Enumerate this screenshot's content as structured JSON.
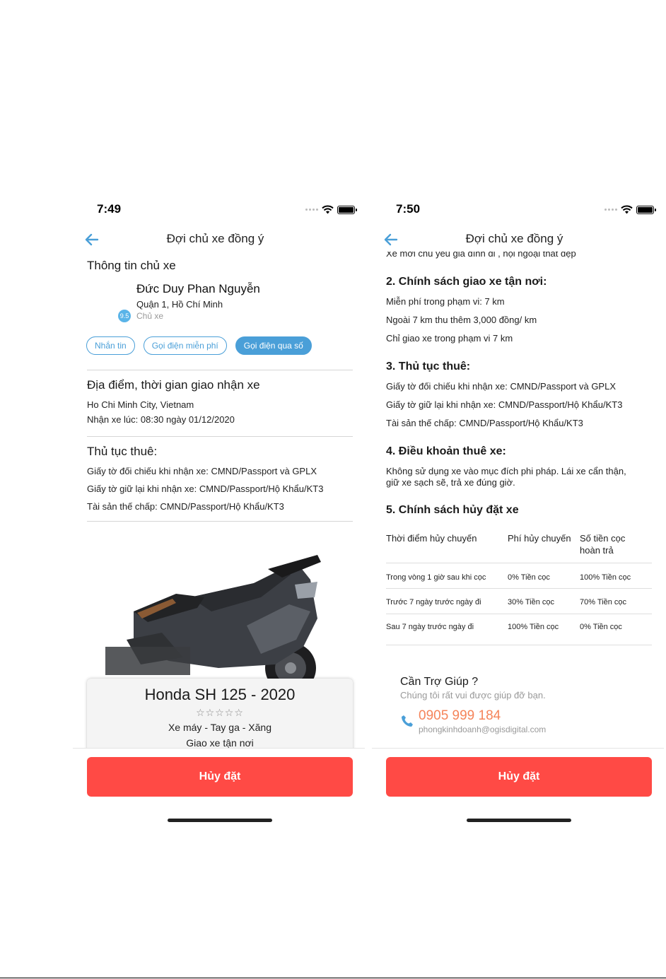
{
  "left": {
    "status_time": "7:49",
    "nav_title": "Đợi chủ xe đồng ý",
    "owner_section_title": "Thông tin chủ xe",
    "owner_name": "Đức Duy Phan Nguyễn",
    "owner_address": "Quận 1, Hồ Chí Minh",
    "owner_rating": "9.5",
    "owner_role": "Chủ xe",
    "buttons": {
      "message": "Nhắn tin",
      "free_call": "Gọi điện miễn phí",
      "phone_call": "Gọi điện qua số"
    },
    "location_title": "Địa điểm, thời gian giao nhận xe",
    "location": "Ho Chi Minh City, Vietnam",
    "pickup_time": "Nhận xe lúc: 08:30 ngày 01/12/2020",
    "procedure_title": "Thủ tục thuê:",
    "procedures": [
      "Giấy tờ đối chiếu khi nhận xe: CMND/Passport và GPLX",
      "Giấy tờ giữ lại khi nhận xe: CMND/Passport/Hộ Khẩu/KT3",
      "Tài sản thế chấp: CMND/Passport/Hộ Khẩu/KT3"
    ],
    "vehicle_name": "Honda SH 125 - 2020",
    "vehicle_stars": "☆☆☆☆☆",
    "vehicle_type": "Xe máy - Tay ga - Xăng",
    "vehicle_delivery": "Giao xe tận nơi",
    "cancel_button": "Hủy đặt"
  },
  "right": {
    "status_time": "7:50",
    "nav_title": "Đợi chủ xe đồng ý",
    "cut_text": "Xe mới chủ yếu gia đình đi , nội ngoại thất đẹp",
    "delivery_title": "2. Chính sách giao xe tận nơi:",
    "delivery_lines": [
      "Miễn phí trong phạm vi: 7 km",
      "Ngoài 7 km thu thêm  3,000 đồng/ km",
      "Chỉ giao xe trong phạm vi 7 km"
    ],
    "procedure_title": "3. Thủ tục thuê:",
    "procedures": [
      "Giấy tờ đối chiếu khi nhận xe: CMND/Passport và GPLX",
      "Giấy tờ giữ lại khi nhận xe: CMND/Passport/Hộ Khẩu/KT3",
      "Tài sản thế chấp: CMND/Passport/Hộ Khẩu/KT3"
    ],
    "terms_title": "4. Điều khoản thuê xe:",
    "terms_text_1": "Không sử dụng xe vào mục đích phi pháp. Lái xe cẩn thận,",
    "terms_text_2": "giữ xe sạch sẽ, trả xe đúng giờ.",
    "cancel_policy_title": "5. Chính sách hủy đặt xe",
    "table_headers": [
      "Thời điểm hủy chuyến",
      "Phí hủy chuyến",
      "Số tiền cọc",
      "hoàn trả"
    ],
    "table_rows": [
      [
        "Trong vòng 1 giờ sau khi cọc",
        "0% Tiền cọc",
        "100% Tiền cọc"
      ],
      [
        "Trước 7 ngày trước ngày đi",
        "30% Tiền cọc",
        "70% Tiền cọc"
      ],
      [
        "Sau 7 ngày trước ngày đi",
        "100% Tiền cọc",
        "0% Tiền cọc"
      ]
    ],
    "help_title": "Cần Trợ Giúp ?",
    "help_subtitle": "Chúng tôi rất vui được giúp đỡ bạn.",
    "help_phone": "0905 999 184",
    "help_email": "phongkinhdoanh@ogisdigital.com",
    "cancel_button": "Hủy đặt"
  },
  "colors": {
    "accent_blue": "#4a9fd8",
    "cancel_red": "#ff4a45",
    "phone_orange": "#f5845a"
  },
  "icons": [
    "back-arrow-icon",
    "wifi-icon",
    "battery-icon",
    "phone-icon",
    "star-icon"
  ]
}
